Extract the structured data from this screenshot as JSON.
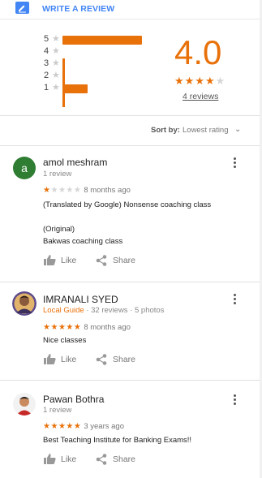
{
  "write_review": {
    "label": "WRITE A REVIEW"
  },
  "summary": {
    "rating": "4.0",
    "rating_value": 4.0,
    "reviews_link": "4 reviews",
    "histogram": [
      {
        "stars": "5",
        "count": 3
      },
      {
        "stars": "4",
        "count": 0
      },
      {
        "stars": "3",
        "count": 0
      },
      {
        "stars": "2",
        "count": 0
      },
      {
        "stars": "1",
        "count": 1
      }
    ],
    "star_glyph": "★"
  },
  "sort": {
    "label": "Sort by:",
    "value": "Lowest rating"
  },
  "reviews": [
    {
      "avatar_letter": "a",
      "name": "amol meshram",
      "meta": "1 review",
      "rating": 1,
      "time": "8 months ago",
      "text_lines": [
        "(Translated by Google) Nonsense coaching class",
        "",
        "(Original)",
        "Bakwas coaching class"
      ],
      "like": "Like",
      "share": "Share"
    },
    {
      "name": "IMRANALI SYED",
      "local_guide": "Local Guide",
      "meta": "· 32 reviews · 5 photos",
      "rating": 5,
      "time": "8 months ago",
      "text_lines": [
        "Nice classes"
      ],
      "like": "Like",
      "share": "Share"
    },
    {
      "name": "Pawan Bothra",
      "meta": "1 review",
      "rating": 5,
      "time": "3 years ago",
      "text_lines": [
        "Best Teaching Institute for Banking Exams!!"
      ],
      "like": "Like",
      "share": "Share"
    }
  ],
  "colors": {
    "accent": "#e8710a",
    "link": "#4285f4",
    "star_off": "#d6d6d6"
  }
}
